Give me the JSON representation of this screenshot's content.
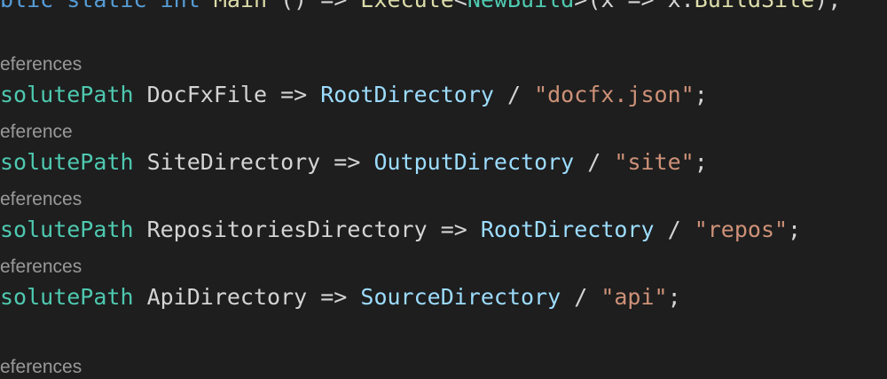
{
  "colors": {
    "background": "#1e1e1e",
    "keyword": "#569cd6",
    "type": "#4ec9b0",
    "method": "#dcdcaa",
    "property": "#9cdcfe",
    "string": "#ce9178",
    "text": "#d4d4d4",
    "codelens": "#999999"
  },
  "top_line": {
    "tokens": [
      "blic ",
      "static ",
      "int ",
      "Main",
      " () => ",
      "Execute",
      "<",
      "NewBuild",
      ">(x => x.",
      "BuildSite",
      ");"
    ]
  },
  "codelens": {
    "lens_1": "eferences",
    "lens_2": "eference",
    "lens_3": "eferences",
    "lens_4": "eferences",
    "lens_5": "eferences"
  },
  "lines": {
    "line_1": {
      "type": "solutePath",
      "name": " DocFxFile ",
      "arrow": "=> ",
      "ref": "RootDirectory",
      "op": " / ",
      "string": "\"docfx.json\"",
      "end": ";"
    },
    "line_2": {
      "type": "solutePath",
      "name": " SiteDirectory ",
      "arrow": "=> ",
      "ref": "OutputDirectory",
      "op": " / ",
      "string": "\"site\"",
      "end": ";"
    },
    "line_3": {
      "type": "solutePath",
      "name": " RepositoriesDirectory ",
      "arrow": "=> ",
      "ref": "RootDirectory",
      "op": " / ",
      "string": "\"repos\"",
      "end": ";"
    },
    "line_4": {
      "type": "solutePath",
      "name": " ApiDirectory ",
      "arrow": "=> ",
      "ref": "SourceDirectory",
      "op": " / ",
      "string": "\"api\"",
      "end": ";"
    }
  }
}
